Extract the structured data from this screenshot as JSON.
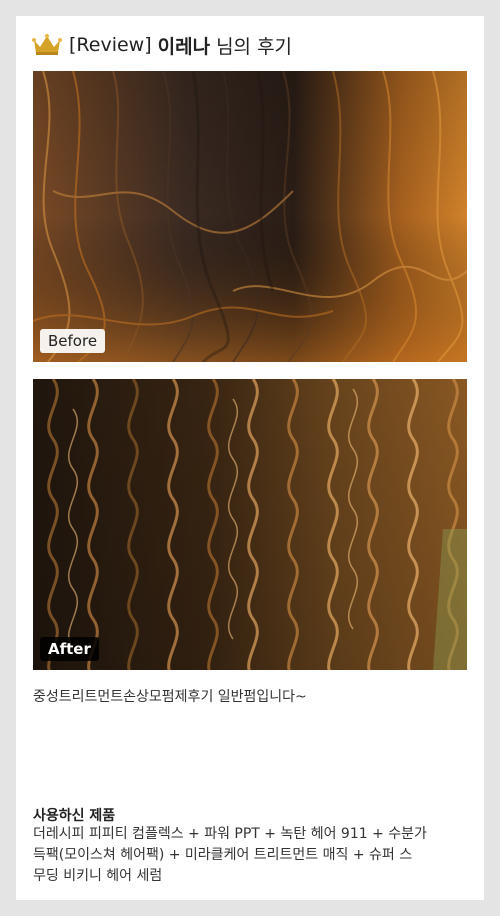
{
  "header": {
    "icon": "crown-icon",
    "bracket_text": "[Review]",
    "reviewer_name": "이레나",
    "suffix": "님의 후기"
  },
  "photos": {
    "before_label": "Before",
    "after_label": "After"
  },
  "review_text": "중성트리트먼트손상모펌제후기 일반펌입니다~",
  "products": {
    "title": "사용하신 제품",
    "text": "더레시피 피피티 컴플렉스 + 파워 PPT + 녹탄 헤어 911 + 수분가\n득팩(모이스쳐 헤어팩) + 미라클케어 트리트먼트 매직 + 슈퍼 스\n무딩 비키니 헤어 세럼"
  },
  "colors": {
    "background": "#e4e4e4",
    "card": "#ffffff",
    "crown": "#d6a329",
    "before_hair_dark": "#2a1d16",
    "before_hair_orange": "#c9741f",
    "after_hair_dark": "#3a2513",
    "after_hair_gold": "#b7752e"
  }
}
